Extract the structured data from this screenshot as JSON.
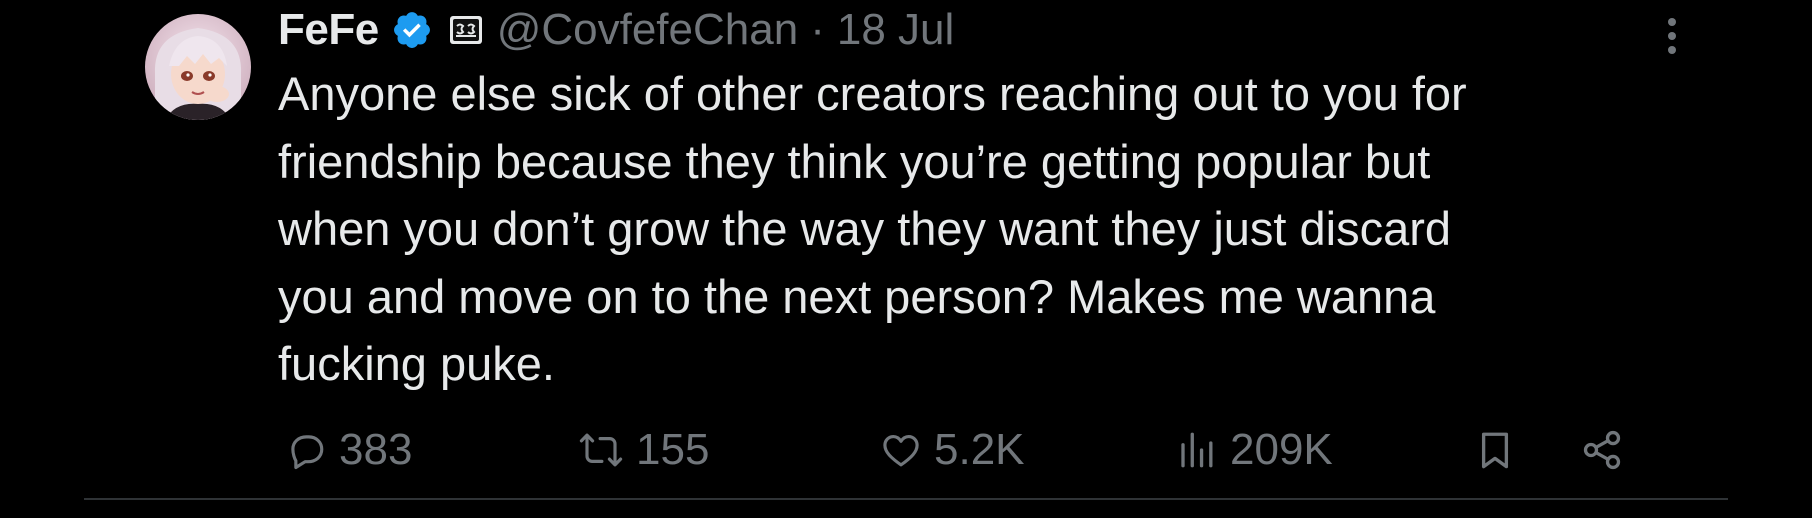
{
  "author": {
    "display_name": "FeFe",
    "handle": "@CovfefeChan",
    "date": "18 Jul",
    "separator": "·",
    "verified_icon": "verified-badge-icon",
    "affiliate_icon": "affiliate-badge-icon",
    "verified_color": "#1d9bf0"
  },
  "tweet": {
    "lines": [
      "Anyone else sick of other creators reaching out to you for",
      "friendship because they think you’re getting popular but",
      "when you don’t grow the way they want they just discard",
      "you and move on to the next person? Makes me wanna",
      "fucking puke."
    ]
  },
  "actions": {
    "replies": "383",
    "reposts": "155",
    "likes": "5.2K",
    "views": "209K"
  },
  "colors": {
    "background": "#000000",
    "text": "#e7e9ea",
    "muted": "#71767b",
    "divider": "#2f3336"
  }
}
